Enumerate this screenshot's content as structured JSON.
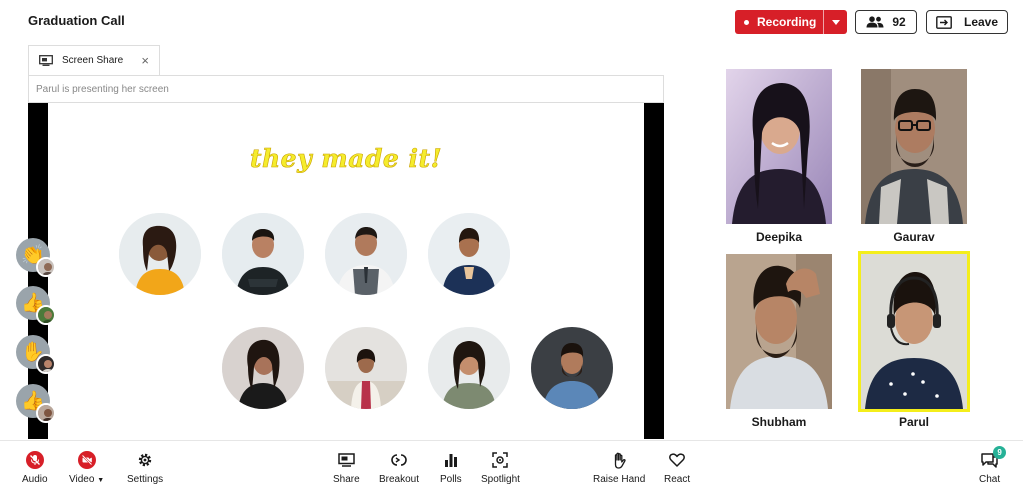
{
  "header": {
    "title": "Graduation Call",
    "recording_label": "Recording",
    "participant_count": "92",
    "leave_label": "Leave"
  },
  "share": {
    "tab_label": "Screen Share",
    "tab_close": "×",
    "presenter_text": "Parul is presenting her screen",
    "slide_title": "they made it!"
  },
  "reactions": [
    {
      "emoji": "👏",
      "icon": "clap-icon"
    },
    {
      "emoji": "👍",
      "icon": "thumbs-up-icon"
    },
    {
      "emoji": "✋",
      "icon": "raised-hand-icon"
    },
    {
      "emoji": "👍",
      "icon": "thumbs-up-icon"
    }
  ],
  "participants": [
    {
      "name": "Deepika"
    },
    {
      "name": "Gaurav"
    },
    {
      "name": "Shubham"
    },
    {
      "name": "Parul",
      "active": true
    }
  ],
  "toolbar": {
    "audio": "Audio",
    "video": "Video",
    "settings": "Settings",
    "share": "Share",
    "breakout": "Breakout",
    "polls": "Polls",
    "spotlight": "Spotlight",
    "raise_hand": "Raise Hand",
    "react": "React",
    "chat": "Chat",
    "chat_badge": "9"
  },
  "colors": {
    "accent_red": "#d71f28",
    "active_speaker": "#f4ee1b",
    "badge_green": "#26b197",
    "slide_title": "#f5ec2c"
  }
}
